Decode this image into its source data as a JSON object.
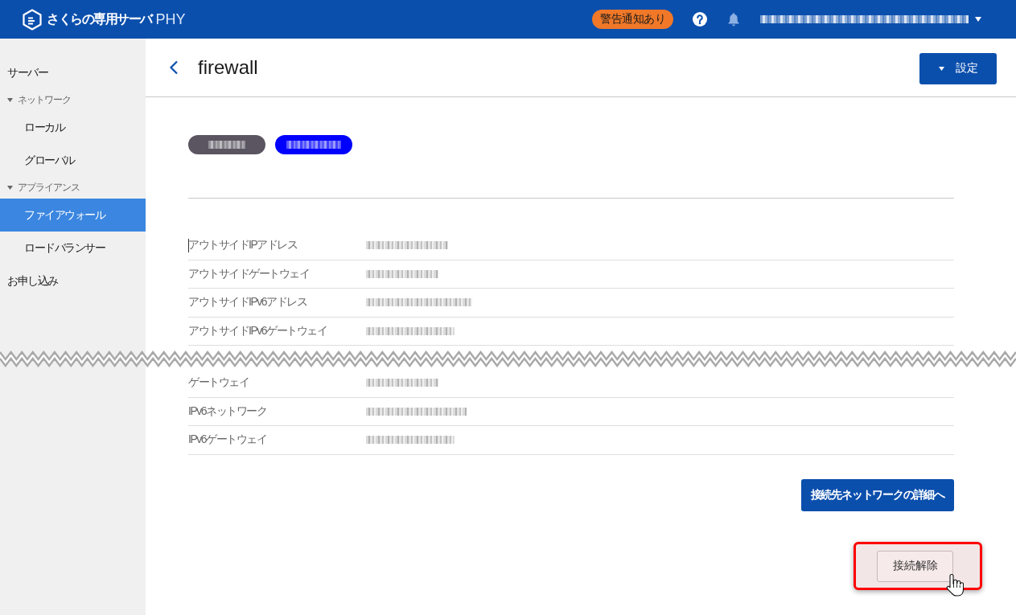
{
  "header": {
    "brand": "さくらの専用サーバ",
    "product": "PHY",
    "alert_badge": "警告通知あり"
  },
  "sidebar": {
    "items": [
      {
        "label": "サーバー",
        "selected": false
      },
      {
        "label": "ネットワーク",
        "selected": false,
        "expanded": true,
        "children": [
          {
            "label": "ローカル",
            "selected": false
          },
          {
            "label": "グローバル",
            "selected": false
          }
        ]
      },
      {
        "label": "アプライアンス",
        "selected": false,
        "expanded": true,
        "children": [
          {
            "label": "ファイアウォール",
            "selected": true
          },
          {
            "label": "ロードバランサー",
            "selected": false
          }
        ]
      },
      {
        "label": "お申し込み",
        "selected": false
      }
    ]
  },
  "page": {
    "title": "firewall",
    "settings_button": "設定",
    "tags": [
      {
        "color": "#5a5560"
      },
      {
        "color": "#0000ff"
      }
    ],
    "details": [
      {
        "kind": "row",
        "label": "アウトサイドIPアドレス",
        "text_cursor": true
      },
      {
        "kind": "row",
        "label": "アウトサイドゲートウェイ",
        "text_cursor": false
      },
      {
        "kind": "row",
        "label": "アウトサイドIPv6アドレス",
        "text_cursor": false
      },
      {
        "kind": "row",
        "label": "アウトサイドIPv6ゲートウェイ",
        "text_cursor": false
      },
      {
        "kind": "break"
      },
      {
        "kind": "row",
        "label": "ゲートウェイ",
        "text_cursor": false
      },
      {
        "kind": "row",
        "label": "IPv6ネットワーク",
        "text_cursor": false
      },
      {
        "kind": "row",
        "label": "IPv6ゲートウェイ",
        "text_cursor": false
      }
    ],
    "network_details_button": "接続先ネットワークの詳細へ",
    "disconnect_button": "接続解除"
  }
}
